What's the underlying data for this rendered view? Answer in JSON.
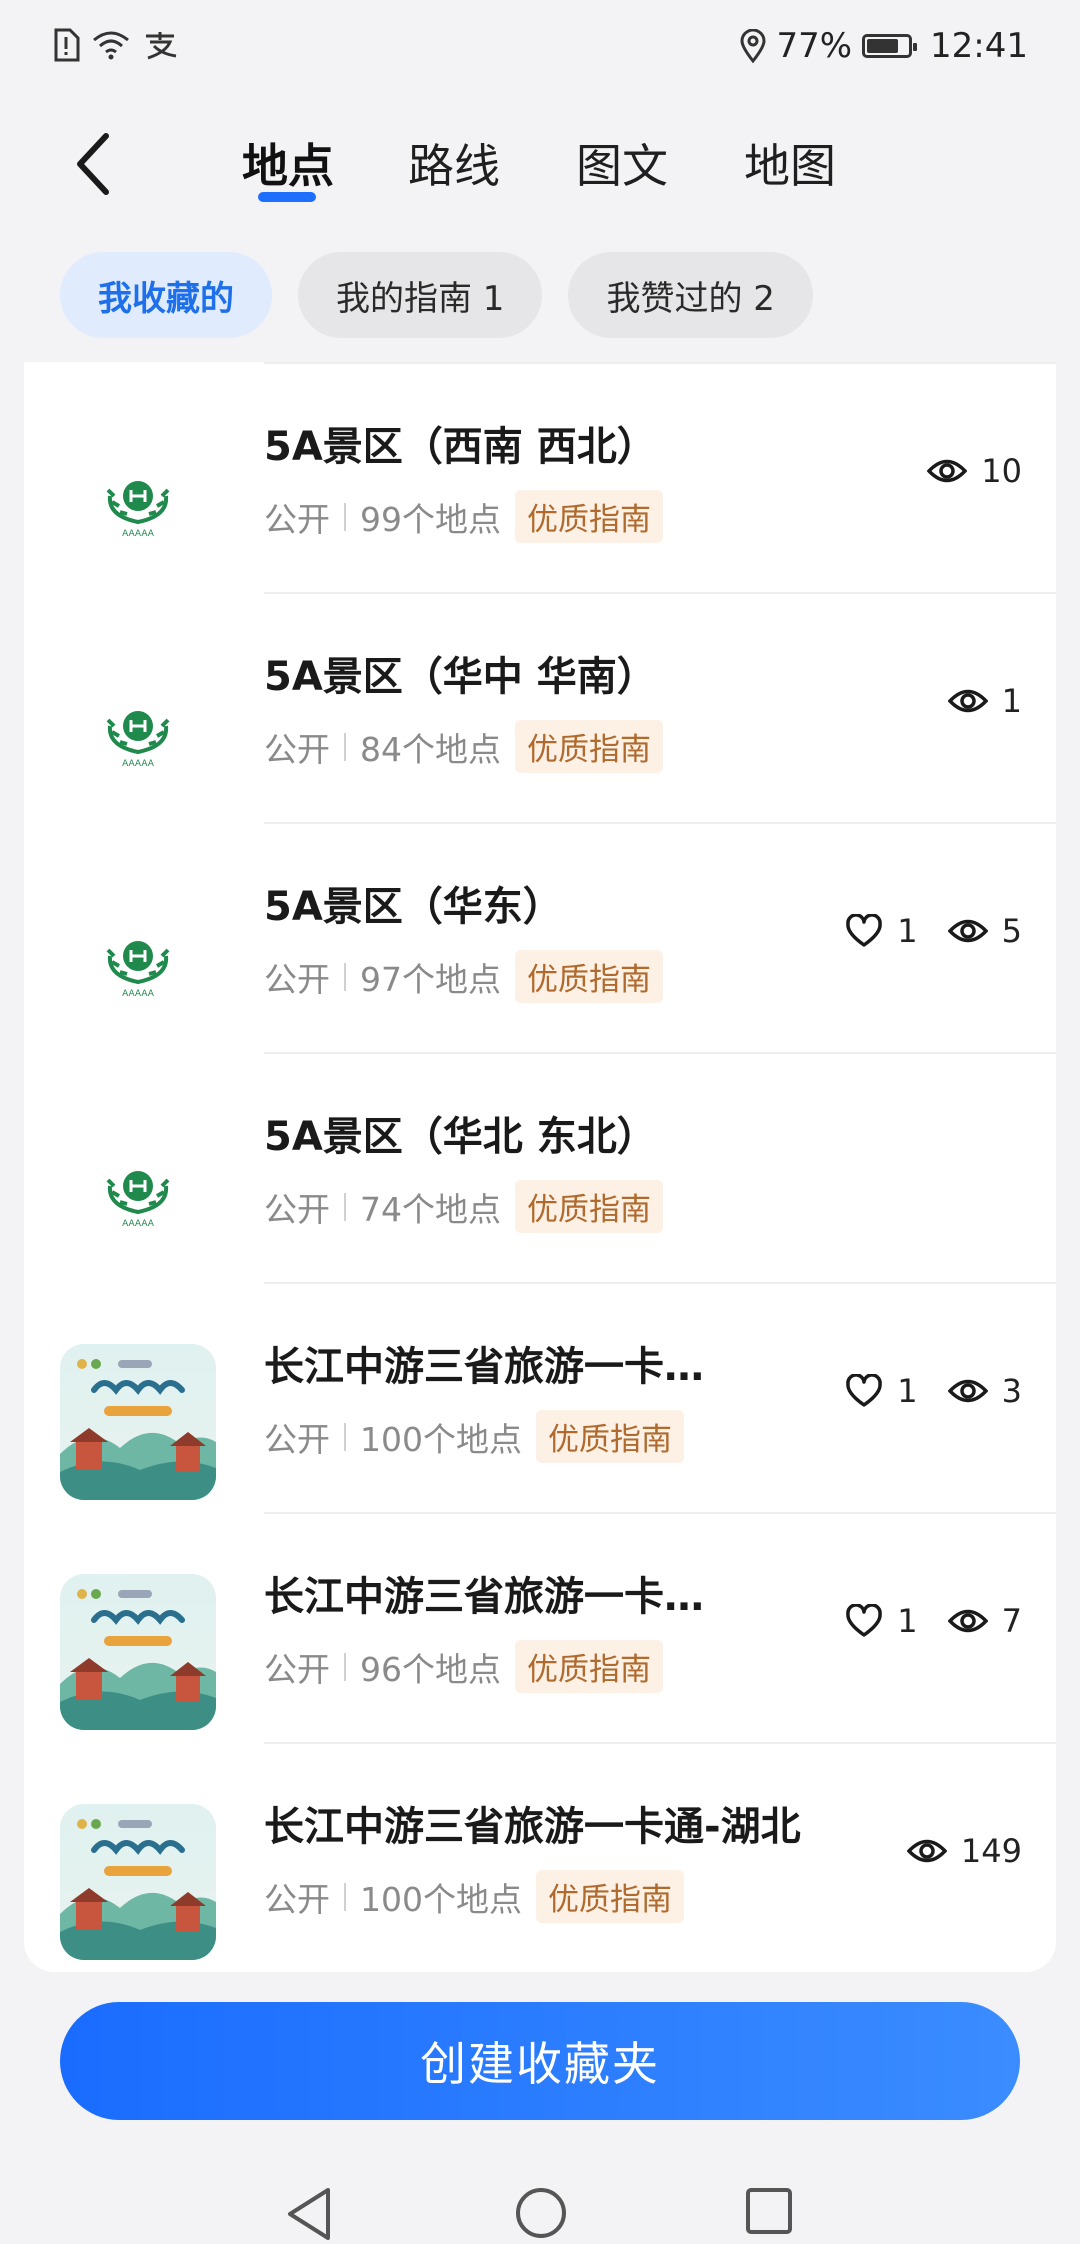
{
  "status_bar": {
    "battery": "77%",
    "battery_level": 0.77,
    "time": "12:41"
  },
  "tabs": [
    {
      "label": "地点",
      "active": true
    },
    {
      "label": "路线",
      "active": false
    },
    {
      "label": "图文",
      "active": false
    },
    {
      "label": "地图",
      "active": false
    }
  ],
  "chips": [
    {
      "label": "我收藏的",
      "active": true
    },
    {
      "label": "我的指南 1",
      "active": false
    },
    {
      "label": "我赞过的 2",
      "active": false
    }
  ],
  "items": [
    {
      "title": "5A景区（西南 西北）",
      "visibility": "公开",
      "count": "99个地点",
      "badge": "优质指南",
      "likes": "",
      "views": "10",
      "thumb": "aaaaa-emblem"
    },
    {
      "title": "5A景区（华中 华南）",
      "visibility": "公开",
      "count": "84个地点",
      "badge": "优质指南",
      "likes": "",
      "views": "1",
      "thumb": "aaaaa-emblem"
    },
    {
      "title": "5A景区（华东）",
      "visibility": "公开",
      "count": "97个地点",
      "badge": "优质指南",
      "likes": "1",
      "views": "5",
      "thumb": "aaaaa-emblem"
    },
    {
      "title": "5A景区（华北 东北）",
      "visibility": "公开",
      "count": "74个地点",
      "badge": "优质指南",
      "likes": "",
      "views": "",
      "thumb": "aaaaa-emblem"
    },
    {
      "title": "长江中游三省旅游一卡通-江...",
      "visibility": "公开",
      "count": "100个地点",
      "badge": "优质指南",
      "likes": "1",
      "views": "3",
      "thumb": "yangtze-poster"
    },
    {
      "title": "长江中游三省旅游一卡通-湖...",
      "visibility": "公开",
      "count": "96个地点",
      "badge": "优质指南",
      "likes": "1",
      "views": "7",
      "thumb": "yangtze-poster"
    },
    {
      "title": "长江中游三省旅游一卡通-湖北",
      "visibility": "公开",
      "count": "100个地点",
      "badge": "优质指南",
      "likes": "",
      "views": "149",
      "thumb": "yangtze-poster"
    }
  ],
  "create_button": "创建收藏夹",
  "colors": {
    "accent": "#1f6fff",
    "badge_bg": "#fdf0e4",
    "badge_text": "#b06a2e"
  }
}
